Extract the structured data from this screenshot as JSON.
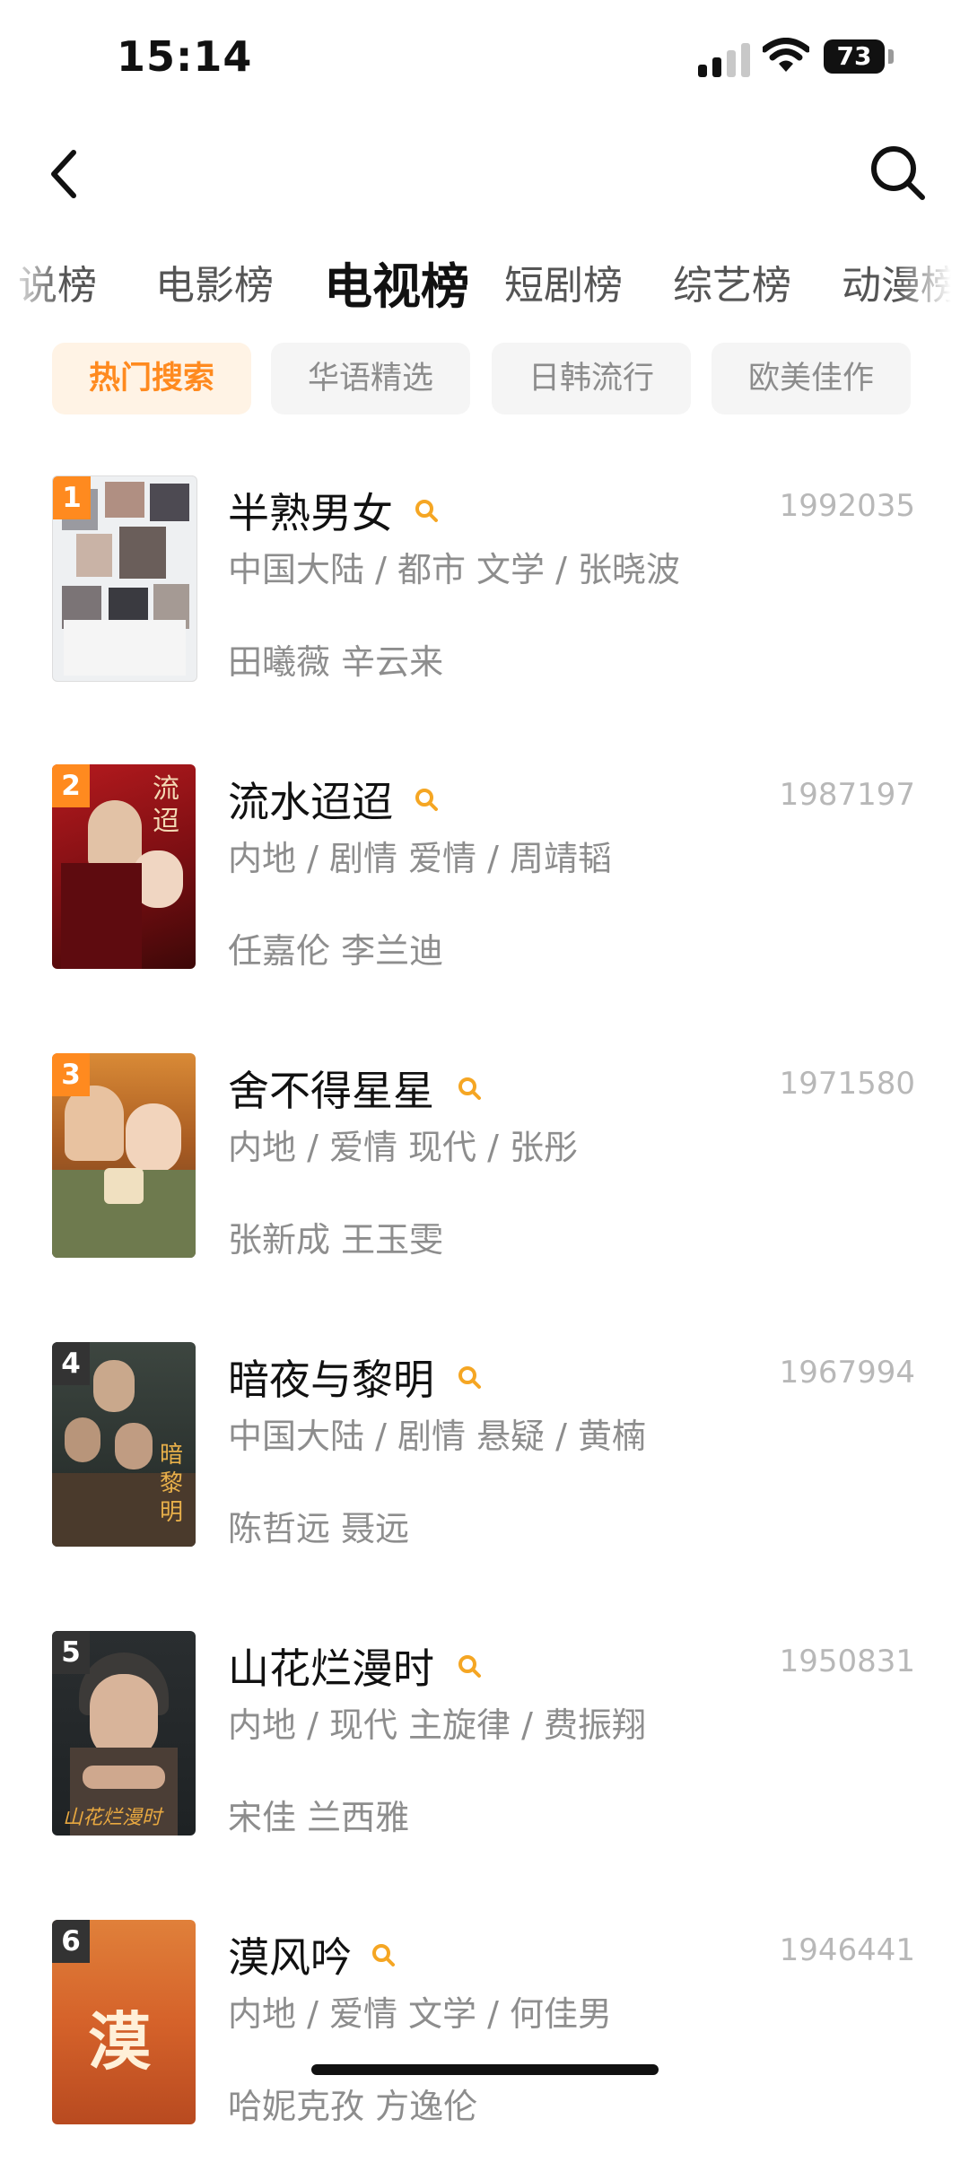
{
  "status_bar": {
    "time": "15:14",
    "battery": "73",
    "icons": [
      "signal-icon",
      "wifi-icon",
      "battery-icon"
    ]
  },
  "nav": {
    "back_icon": "chevron-left-icon",
    "search_icon": "search-icon"
  },
  "category_tabs": [
    {
      "label": "说榜",
      "active": false
    },
    {
      "label": "电影榜",
      "active": false
    },
    {
      "label": "电视榜",
      "active": true
    },
    {
      "label": "短剧榜",
      "active": false
    },
    {
      "label": "综艺榜",
      "active": false
    },
    {
      "label": "动漫榜",
      "active": false
    }
  ],
  "sub_tabs": [
    {
      "label": "热门搜索",
      "active": true
    },
    {
      "label": "华语精选",
      "active": false
    },
    {
      "label": "日韩流行",
      "active": false
    },
    {
      "label": "欧美佳作",
      "active": false
    }
  ],
  "colors": {
    "accent": "#ff8a1f",
    "rank_top3": "#ff8a1f",
    "rank_other": "#333333",
    "muted_text": "#8d8d8d",
    "count_text": "#b8b8b8"
  },
  "items": [
    {
      "rank": "1",
      "title": "半熟男女",
      "count": "1992035",
      "meta": "中国大陆 / 都市 文学 / 张晓波",
      "cast": "田曦薇 辛云来"
    },
    {
      "rank": "2",
      "title": "流水迢迢",
      "count": "1987197",
      "meta": "内地 / 剧情 爱情 / 周靖韬",
      "cast": "任嘉伦 李兰迪"
    },
    {
      "rank": "3",
      "title": "舍不得星星",
      "count": "1971580",
      "meta": "内地 / 爱情 现代 / 张彤",
      "cast": "张新成 王玉雯"
    },
    {
      "rank": "4",
      "title": "暗夜与黎明",
      "count": "1967994",
      "meta": "中国大陆 / 剧情 悬疑 / 黄楠",
      "cast": "陈哲远 聂远"
    },
    {
      "rank": "5",
      "title": "山花烂漫时",
      "count": "1950831",
      "meta": "内地 / 现代 主旋律 / 费振翔",
      "cast": "宋佳 兰西雅"
    },
    {
      "rank": "6",
      "title": "漠风吟",
      "count": "1946441",
      "meta": "内地 / 爱情 文学 / 何佳男",
      "cast": "哈妮克孜 方逸伦"
    }
  ]
}
